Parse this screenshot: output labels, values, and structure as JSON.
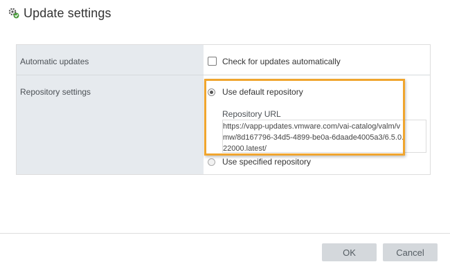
{
  "dialog": {
    "title": "Update settings",
    "icon": "update-settings-icon"
  },
  "settings": {
    "automatic_updates": {
      "label": "Automatic updates",
      "checkbox_label": "Check for updates automatically",
      "checked": false
    },
    "repository": {
      "label": "Repository settings",
      "default_option": "Use default repository",
      "default_selected": true,
      "url_label": "Repository URL",
      "url_value": "https://vapp-updates.vmware.com/vai-catalog/valm/vmw/8d167796-34d5-4899-be0a-6daade4005a3/6.5.0.22000.latest/",
      "specified_option": "Use specified repository",
      "specified_selected": false
    }
  },
  "highlight_color": "#f0a52e",
  "buttons": {
    "ok": "OK",
    "cancel": "Cancel"
  }
}
